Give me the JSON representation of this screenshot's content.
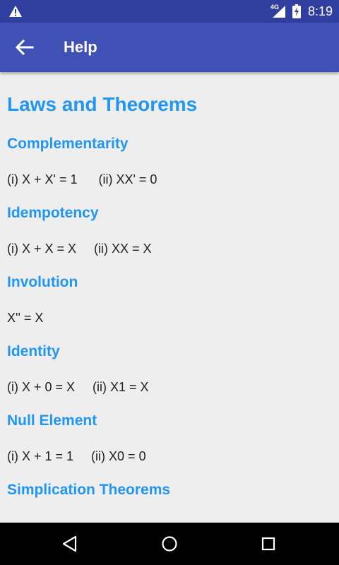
{
  "status_bar": {
    "network_type": "4G",
    "time": "8:19",
    "icons": [
      "warning-icon",
      "signal-icon",
      "battery-charging-icon"
    ]
  },
  "app_bar": {
    "title": "Help",
    "back_icon": "arrow-back-icon"
  },
  "content": {
    "heading": "Laws and Theorems",
    "sections": [
      {
        "title": "Complementarity",
        "text": "(i) X + X' = 1      (ii) XX' = 0"
      },
      {
        "title": "Idempotency",
        "text": "(i) X + X = X     (ii) XX = X"
      },
      {
        "title": "Involution",
        "text": "X'' = X"
      },
      {
        "title": "Identity",
        "text": "(i) X + 0 = X     (ii) X1 = X"
      },
      {
        "title": "Null Element",
        "text": "(i) X + 1 = 1     (ii) X0 = 0"
      },
      {
        "title": "Simplication Theorems",
        "text": ""
      }
    ]
  },
  "nav_bar": {
    "icons": [
      "back-triangle-icon",
      "home-circle-icon",
      "recents-square-icon"
    ]
  },
  "colors": {
    "status_bar": "#303f9f",
    "app_bar": "#3f51b5",
    "accent": "#2196f3",
    "background": "#eeeeee"
  }
}
